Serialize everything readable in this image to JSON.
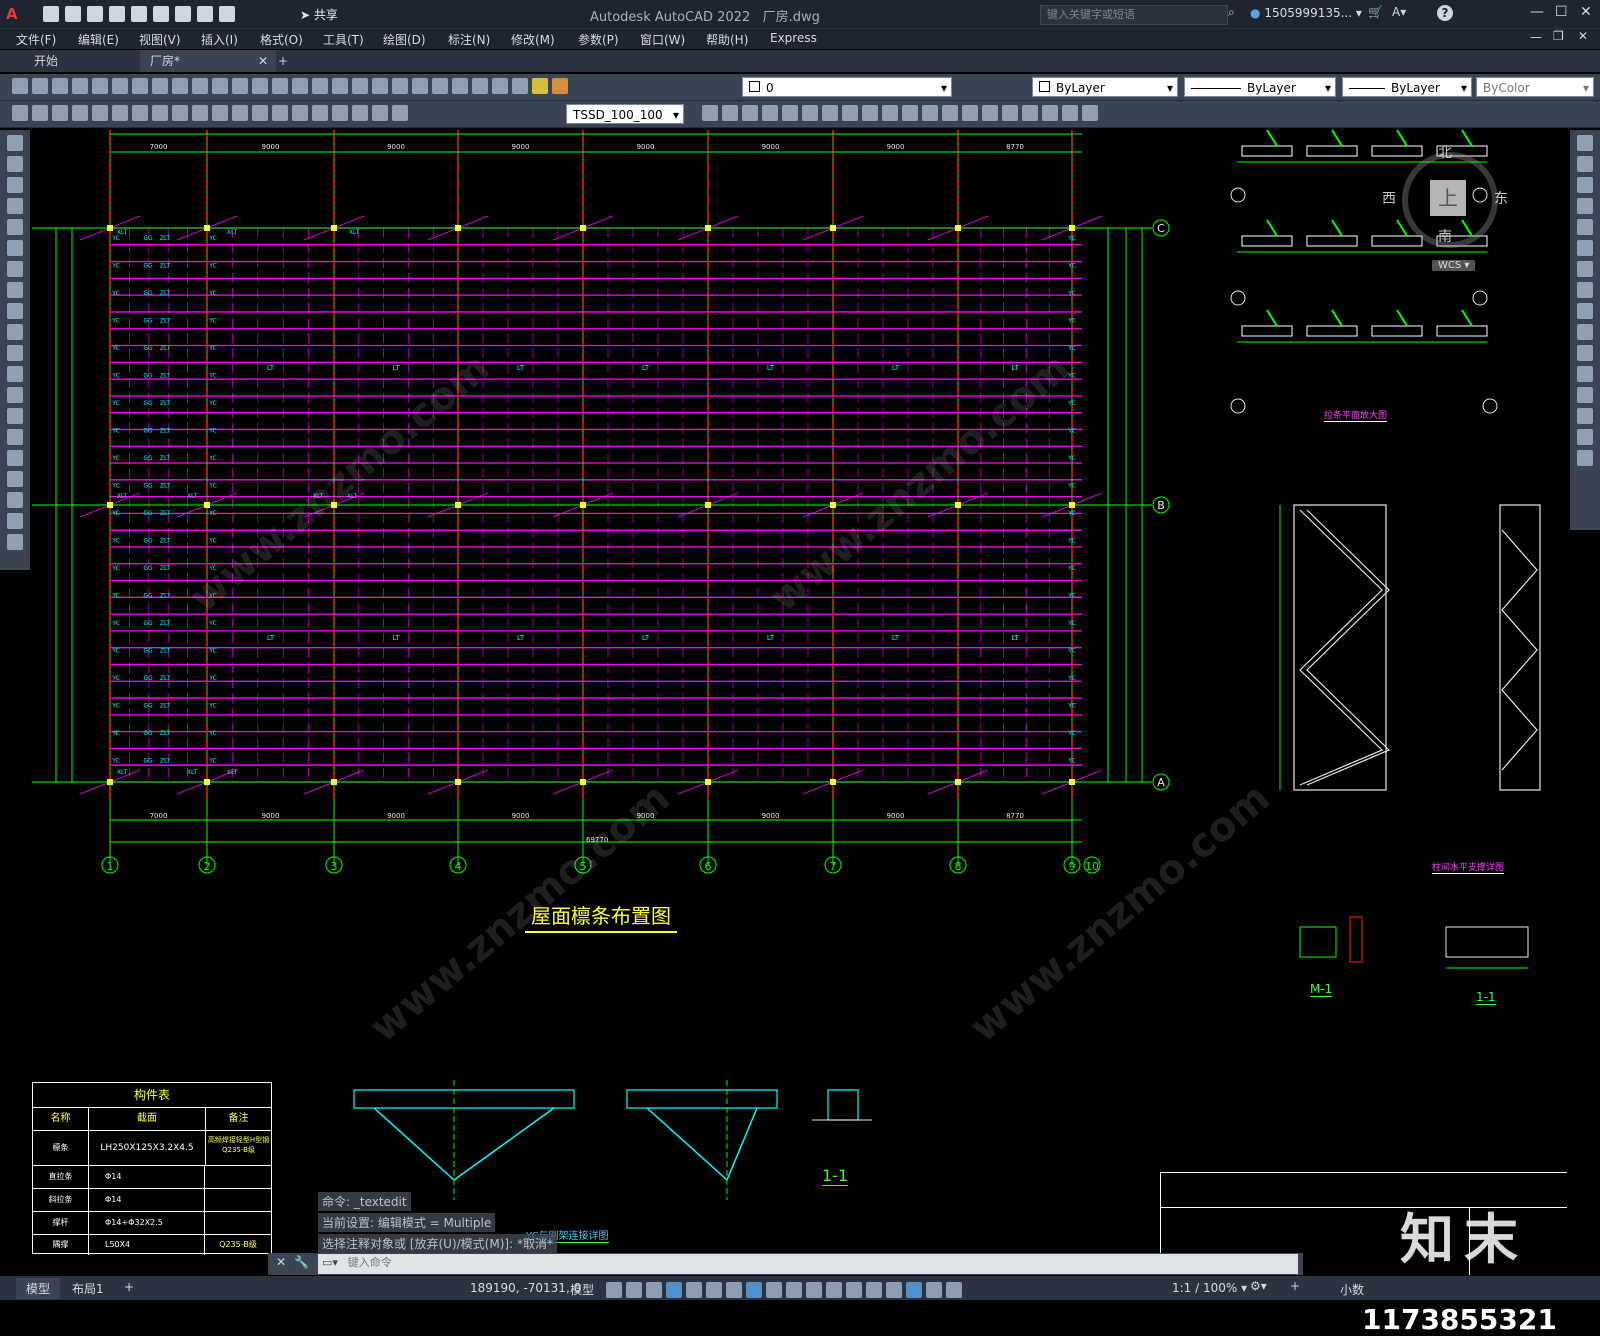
{
  "titlebar": {
    "app_title": "Autodesk AutoCAD 2022",
    "file_name": "厂房.dwg",
    "share_label": "共享",
    "search_placeholder": "键入关键字或短语",
    "user": "1505999135...",
    "help": "?"
  },
  "menu": [
    "文件(F)",
    "编辑(E)",
    "视图(V)",
    "插入(I)",
    "格式(O)",
    "工具(T)",
    "绘图(D)",
    "标注(N)",
    "修改(M)",
    "参数(P)",
    "窗口(W)",
    "帮助(H)",
    "Express"
  ],
  "tabs": [
    {
      "label": "开始"
    },
    {
      "label": "厂房*"
    }
  ],
  "layer_combo": "0",
  "color_combo": "ByLayer",
  "linetype_combo": "ByLayer",
  "lineweight_combo": "ByLayer",
  "plotstyle_combo": "ByColor",
  "dimstyle_combo": "TSSD_100_100",
  "drawing": {
    "plan_title": "屋面檩条布置图",
    "axis_numbers": [
      "1",
      "2",
      "3",
      "4",
      "5",
      "6",
      "7",
      "8",
      "9",
      "10"
    ],
    "axis_letters": [
      "C",
      "B",
      "A"
    ],
    "top_total_dim": "69770",
    "bottom_total_dim": "69770",
    "bay_dims": [
      "7000",
      "9000",
      "9000",
      "9000",
      "9000",
      "9000",
      "9000",
      "8770"
    ],
    "member_labels": {
      "lt": "LT",
      "yc": "YC",
      "xlt": "XLT",
      "zlt": "ZLT",
      "gg": "GG"
    },
    "viewcube": {
      "north": "北",
      "south": "南",
      "east": "东",
      "west": "西",
      "top": "上",
      "wcs": "WCS"
    },
    "detail_plan_title": "拉条平面放大图",
    "bracing_title": "柱间水平支撑详图",
    "section_m1": "M-1",
    "section_11": "1-1",
    "section_11b": "1-1",
    "node_detail_title": "YC与刚架连接详图",
    "table": {
      "title": "构件表",
      "headers": [
        "名称",
        "截面",
        "备注"
      ],
      "rows": [
        [
          "檩条",
          "LH250X125X3.2X4.5",
          "高频焊接轻型H型钢 Q235-B级"
        ],
        [
          "直拉条",
          "Φ14",
          ""
        ],
        [
          "斜拉条",
          "Φ14",
          ""
        ],
        [
          "撑杆",
          "Φ14+Φ32X2.5",
          ""
        ],
        [
          "隅撑",
          "L50X4",
          "Q235-B级"
        ]
      ]
    }
  },
  "command": {
    "history": [
      "命令: _textedit",
      "当前设置: 编辑模式 = Multiple",
      "选择注释对象或 [放弃(U)/模式(M)]: *取消*"
    ],
    "input_placeholder": "键入命令"
  },
  "status": {
    "layout_tabs": [
      "模型",
      "布局1"
    ],
    "coords": "189190, -70131, 0",
    "space": "模型",
    "scale": "1:1 / 100%",
    "decimal": "小数"
  },
  "watermark": {
    "site": "www.znzmo.com",
    "brand": "知末",
    "id": "ID: 1173855321"
  }
}
